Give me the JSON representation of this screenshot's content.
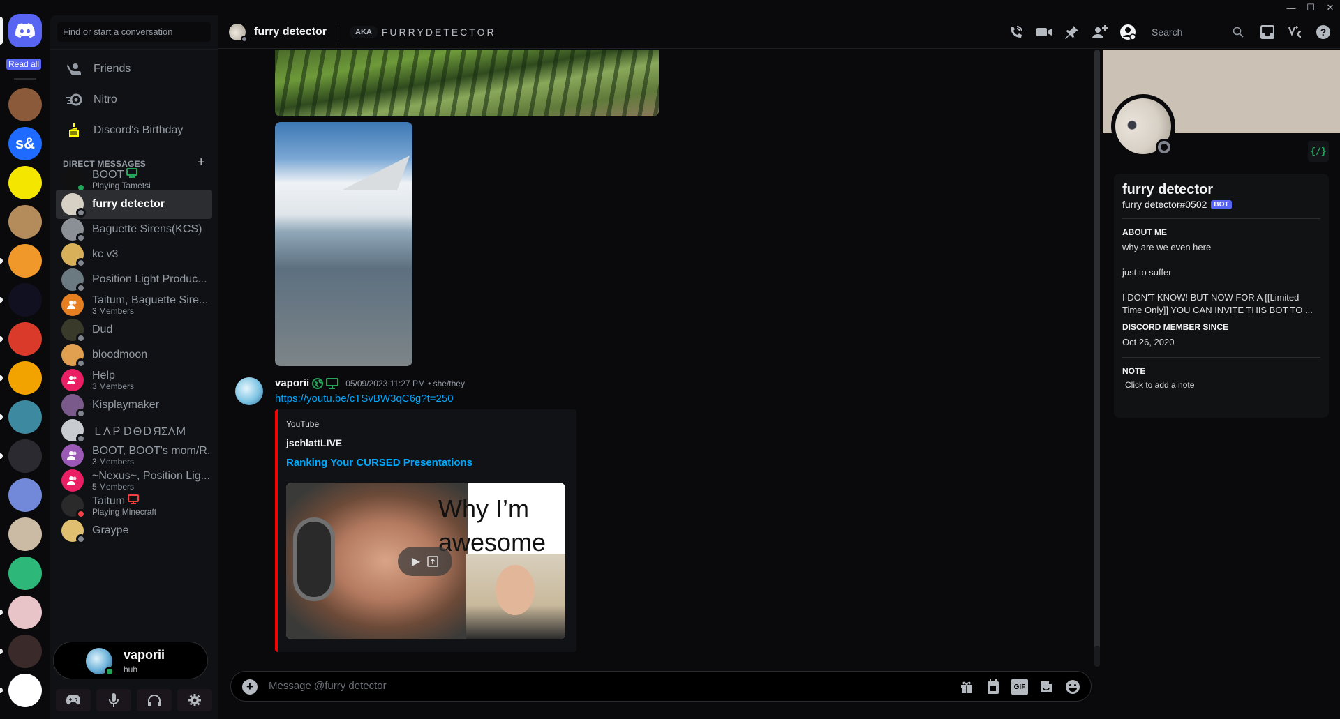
{
  "window": {
    "minimize": "—",
    "maximize": "☐",
    "close": "✕"
  },
  "rail": {
    "home_label": "Discord Home",
    "read_all": "Read all",
    "servers": [
      {
        "name": "server-face",
        "color": "#8a5a3a",
        "text": ""
      },
      {
        "name": "server-s-and",
        "color": "#1f6bff",
        "text": "s&"
      },
      {
        "name": "server-yellow-block",
        "color": "#f5e600",
        "text": ""
      },
      {
        "name": "server-fruit",
        "color": "#b48c5c",
        "text": ""
      },
      {
        "name": "server-orange-creature",
        "color": "#f0982a",
        "text": ""
      },
      {
        "name": "server-blue-block",
        "color": "#101020",
        "text": ""
      },
      {
        "name": "server-uno",
        "color": "#d93a2a",
        "text": ""
      },
      {
        "name": "server-fire",
        "color": "#f2a300",
        "text": ""
      },
      {
        "name": "server-teal-creature",
        "color": "#3d8aa0",
        "text": ""
      },
      {
        "name": "server-rainbow-sphere",
        "color": "#2a2a30",
        "text": ""
      },
      {
        "name": "server-python",
        "color": "#7289da",
        "text": ""
      },
      {
        "name": "server-keycap",
        "color": "#cbbba5",
        "text": ""
      },
      {
        "name": "server-green-logo",
        "color": "#2db87a",
        "text": ""
      },
      {
        "name": "server-anime",
        "color": "#e8c4c8",
        "text": ""
      },
      {
        "name": "server-monitor",
        "color": "#3a2a2a",
        "text": ""
      },
      {
        "name": "server-code-bubble",
        "color": "#ffffff",
        "text": ""
      }
    ]
  },
  "sidebar": {
    "search_placeholder": "Find or start a conversation",
    "nav": [
      {
        "label": "Friends"
      },
      {
        "label": "Nitro"
      },
      {
        "label": "Discord's Birthday"
      }
    ],
    "dm_header": "DIRECT MESSAGES",
    "dm_add": "+",
    "dms": [
      {
        "name": "BOOT",
        "sub": "Playing Tametsi",
        "status": "online",
        "avatar_color": "#111",
        "activity": "desktop-green"
      },
      {
        "name": "furry detector",
        "sub": "",
        "status": "offline",
        "avatar_color": "#d7d0c5",
        "active": true
      },
      {
        "name": "Baguette Sirens(KCS)",
        "sub": "",
        "status": "offline",
        "avatar_color": "#8a9096"
      },
      {
        "name": "kc v3",
        "sub": "",
        "status": "offline",
        "avatar_color": "#d8b05a"
      },
      {
        "name": "Position Light Produc...",
        "sub": "",
        "status": "offline",
        "avatar_color": "#6b7a80"
      },
      {
        "name": "Taitum, Baguette Sire...",
        "sub": "3 Members",
        "group": true,
        "avatar_color": "#e67e22"
      },
      {
        "name": "Dud",
        "sub": "",
        "status": "offline",
        "avatar_color": "#3a3a2a"
      },
      {
        "name": "bloodmoon",
        "sub": "",
        "status": "offline",
        "avatar_color": "#e0a050"
      },
      {
        "name": "Help",
        "sub": "3 Members",
        "group": true,
        "avatar_color": "#e91e63"
      },
      {
        "name": "Kisplaymaker",
        "sub": "",
        "status": "offline",
        "avatar_color": "#7a5a8a"
      },
      {
        "name": "ＬΛＰＤΘＤЯΣΛＭ",
        "sub": "",
        "status": "offline",
        "avatar_color": "#c8ccd0"
      },
      {
        "name": "BOOT, BOOT's mom/R...",
        "sub": "3 Members",
        "group": true,
        "avatar_color": "#9b59b6"
      },
      {
        "name": "~Nexus~, Position Lig...",
        "sub": "5 Members",
        "group": true,
        "avatar_color": "#e91e63"
      },
      {
        "name": "Taitum",
        "sub": "Playing Minecraft",
        "status": "dnd",
        "avatar_color": "#2a2a2a",
        "activity": "desktop-red"
      },
      {
        "name": "Graype",
        "sub": "",
        "status": "offline",
        "avatar_color": "#e0c070"
      }
    ]
  },
  "user": {
    "name": "vaporii",
    "status_text": "huh"
  },
  "user_controls": [
    "game-controller",
    "microphone",
    "headphones",
    "settings"
  ],
  "header": {
    "title": "furry detector",
    "aka_label": "AKA",
    "aka_name": "FURRYDETECTOR",
    "search_placeholder": "Search"
  },
  "message": {
    "author": "vaporii",
    "timestamp": "05/09/2023 11:27 PM",
    "pronouns": "• she/they",
    "link": "https://youtu.be/cTSvBW3qC6g?t=250",
    "embed": {
      "provider": "YouTube",
      "author": "jschlattLIVE",
      "title": "Ranking Your CURSED Presentations",
      "thumb_text": "Why I’m awesome",
      "accent_color": "#ff0000"
    }
  },
  "composer": {
    "placeholder": "Message @furry detector",
    "gif": "GIF"
  },
  "profile": {
    "display_name": "furry detector",
    "tag": "furry detector#0502",
    "bot_badge": "BOT",
    "dev_badge": "{/}",
    "about_label": "ABOUT ME",
    "about_lines": [
      "why are we even here",
      "just to suffer",
      "I DON'T KNOW! BUT NOW FOR A [[Limited Time Only]] YOU CAN INVITE THIS BOT TO ..."
    ],
    "member_since_label": "DISCORD MEMBER SINCE",
    "member_since": "Oct 26, 2020",
    "note_label": "NOTE",
    "note_placeholder": "Click to add a note",
    "banner_color": "#ccc1b5"
  }
}
